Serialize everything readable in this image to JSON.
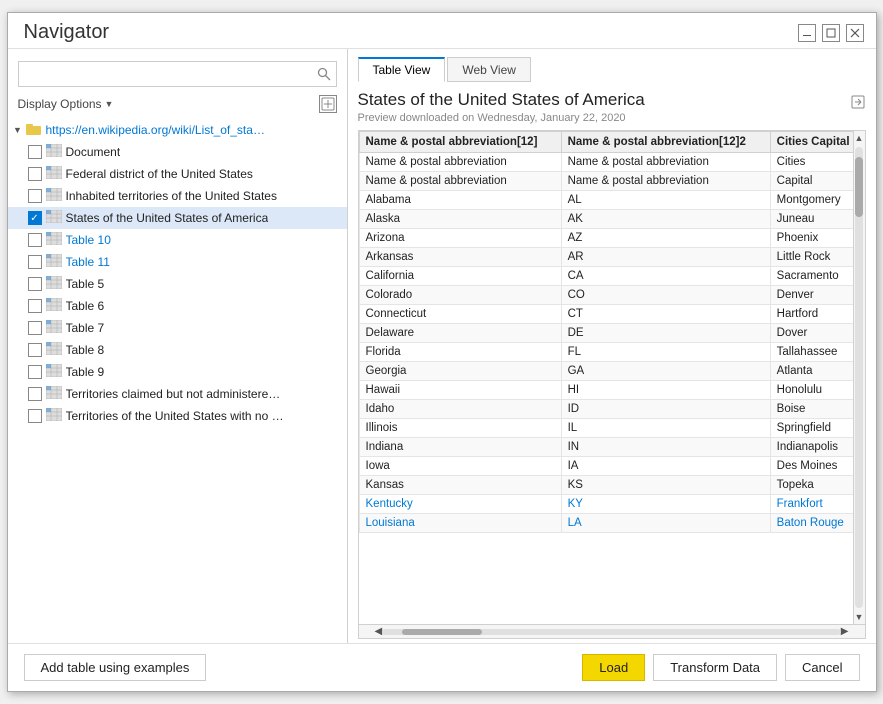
{
  "dialog": {
    "title": "Navigator",
    "minimize_label": "minimize",
    "maximize_label": "maximize",
    "close_label": "close"
  },
  "search": {
    "placeholder": ""
  },
  "display_options": {
    "label": "Display Options",
    "icon_label": "settings-icon"
  },
  "tree": {
    "root": {
      "label": "https://en.wikipedia.org/wiki/List_of_states_an...",
      "expanded": true
    },
    "items": [
      {
        "label": "Document",
        "link": false,
        "selected": false,
        "checked": false
      },
      {
        "label": "Federal district of the United States",
        "link": false,
        "selected": false,
        "checked": false
      },
      {
        "label": "Inhabited territories of the United States",
        "link": false,
        "selected": false,
        "checked": false
      },
      {
        "label": "States of the United States of America",
        "link": false,
        "selected": true,
        "checked": true
      },
      {
        "label": "Table 10",
        "link": true,
        "selected": false,
        "checked": false
      },
      {
        "label": "Table 11",
        "link": true,
        "selected": false,
        "checked": false
      },
      {
        "label": "Table 5",
        "link": false,
        "selected": false,
        "checked": false
      },
      {
        "label": "Table 6",
        "link": false,
        "selected": false,
        "checked": false
      },
      {
        "label": "Table 7",
        "link": false,
        "selected": false,
        "checked": false
      },
      {
        "label": "Table 8",
        "link": false,
        "selected": false,
        "checked": false
      },
      {
        "label": "Table 9",
        "link": false,
        "selected": false,
        "checked": false
      },
      {
        "label": "Territories claimed but not administered b...",
        "link": false,
        "selected": false,
        "checked": false
      },
      {
        "label": "Territories of the United States with no in...",
        "link": false,
        "selected": false,
        "checked": false
      }
    ]
  },
  "tabs": [
    {
      "label": "Table View",
      "active": true
    },
    {
      "label": "Web View",
      "active": false
    }
  ],
  "preview": {
    "title": "States of the United States of America",
    "subtitle": "Preview downloaded on Wednesday, January 22, 2020"
  },
  "table": {
    "headers": [
      "Name & postal abbreviation[12]",
      "Name & postal abbreviation[12]2",
      "Cities Capital"
    ],
    "rows": [
      {
        "col1": "Name & postal abbreviation",
        "col2": "Name & postal abbreviation",
        "col3": "Cities",
        "highlight": false
      },
      {
        "col1": "Name & postal abbreviation",
        "col2": "Name & postal abbreviation",
        "col3": "Capital",
        "highlight": false
      },
      {
        "col1": "Alabama",
        "col2": "AL",
        "col3": "Montgomery",
        "highlight": false
      },
      {
        "col1": "Alaska",
        "col2": "AK",
        "col3": "Juneau",
        "highlight": false
      },
      {
        "col1": "Arizona",
        "col2": "AZ",
        "col3": "Phoenix",
        "highlight": false
      },
      {
        "col1": "Arkansas",
        "col2": "AR",
        "col3": "Little Rock",
        "highlight": false
      },
      {
        "col1": "California",
        "col2": "CA",
        "col3": "Sacramento",
        "highlight": false
      },
      {
        "col1": "Colorado",
        "col2": "CO",
        "col3": "Denver",
        "highlight": false
      },
      {
        "col1": "Connecticut",
        "col2": "CT",
        "col3": "Hartford",
        "highlight": false
      },
      {
        "col1": "Delaware",
        "col2": "DE",
        "col3": "Dover",
        "highlight": false
      },
      {
        "col1": "Florida",
        "col2": "FL",
        "col3": "Tallahassee",
        "highlight": false
      },
      {
        "col1": "Georgia",
        "col2": "GA",
        "col3": "Atlanta",
        "highlight": false
      },
      {
        "col1": "Hawaii",
        "col2": "HI",
        "col3": "Honolulu",
        "highlight": false
      },
      {
        "col1": "Idaho",
        "col2": "ID",
        "col3": "Boise",
        "highlight": false
      },
      {
        "col1": "Illinois",
        "col2": "IL",
        "col3": "Springfield",
        "highlight": false
      },
      {
        "col1": "Indiana",
        "col2": "IN",
        "col3": "Indianapolis",
        "highlight": false
      },
      {
        "col1": "Iowa",
        "col2": "IA",
        "col3": "Des Moines",
        "highlight": false
      },
      {
        "col1": "Kansas",
        "col2": "KS",
        "col3": "Topeka",
        "highlight": false
      },
      {
        "col1": "Kentucky",
        "col2": "KY",
        "col3": "Frankfort",
        "highlight": true
      },
      {
        "col1": "Louisiana",
        "col2": "LA",
        "col3": "Baton Rouge",
        "highlight": true
      }
    ]
  },
  "footer": {
    "add_example_label": "Add table using examples",
    "load_label": "Load",
    "transform_label": "Transform Data",
    "cancel_label": "Cancel"
  }
}
